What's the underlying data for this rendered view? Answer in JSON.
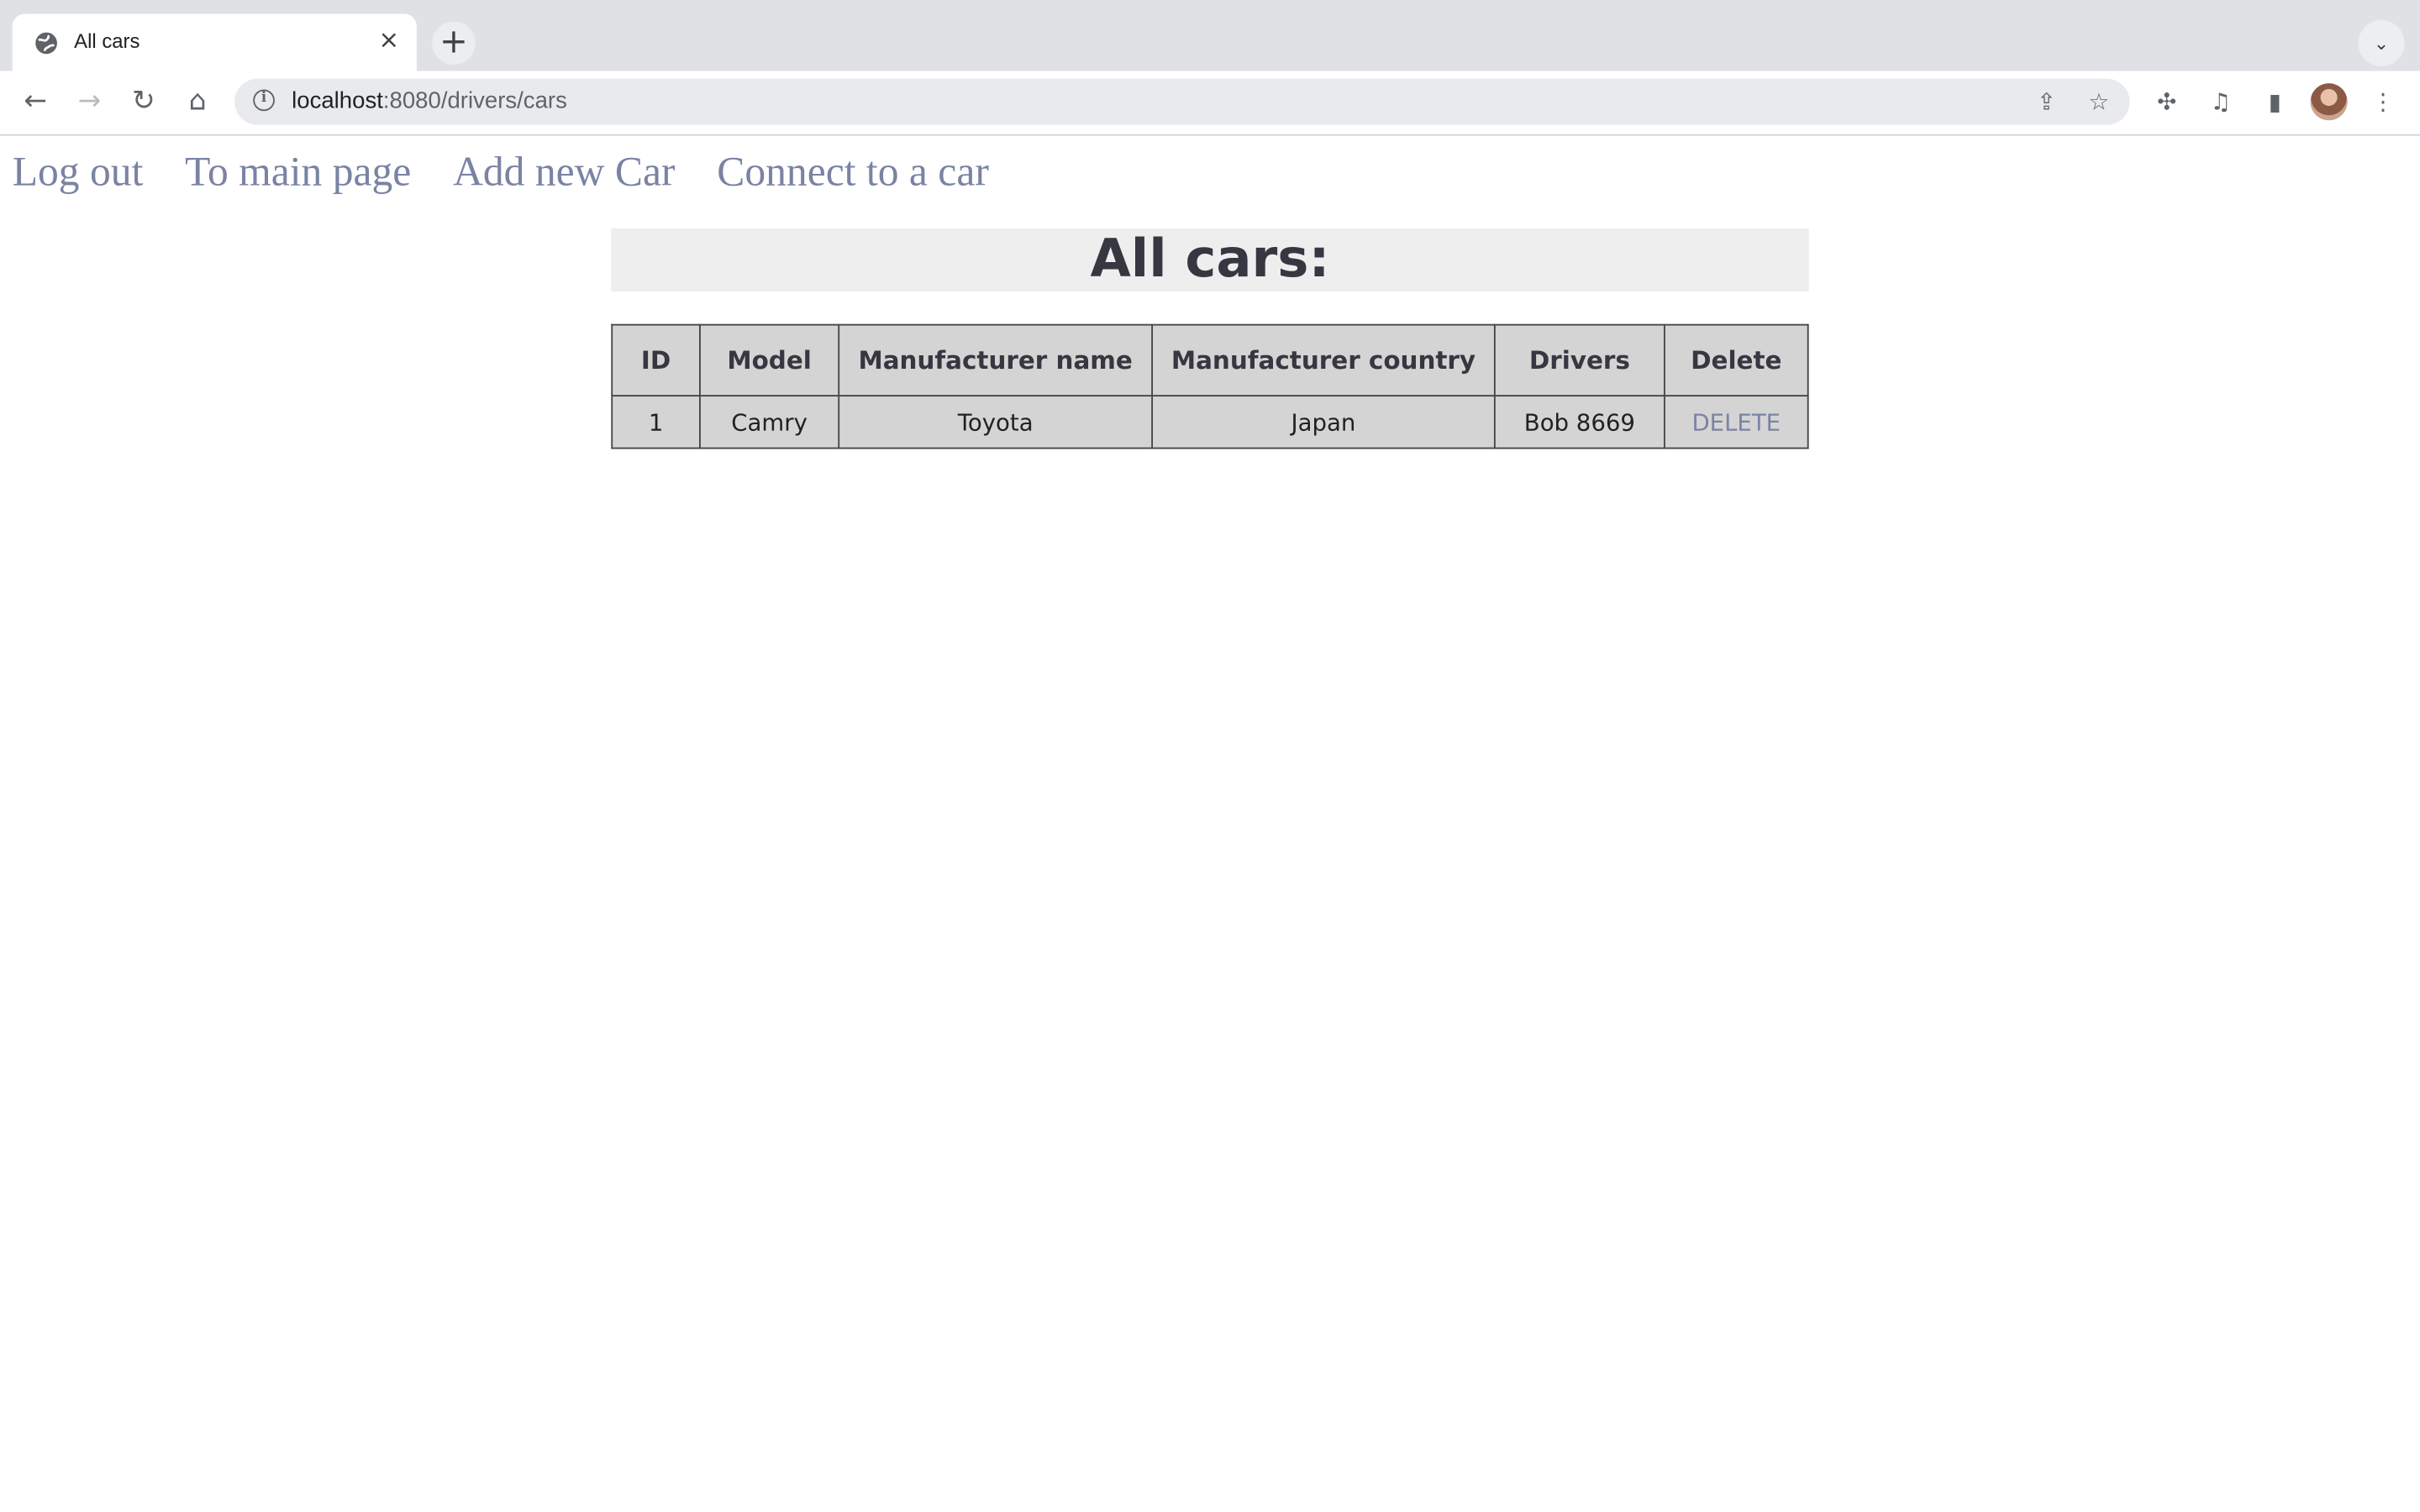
{
  "browser": {
    "tab_title": "All cars",
    "url_host": "localhost",
    "url_rest": ":8080/drivers/cars"
  },
  "nav": {
    "links": [
      "Log out",
      "To main page",
      "Add new Car",
      "Connect to a car"
    ]
  },
  "page": {
    "heading": "All cars:"
  },
  "table": {
    "headers": [
      "ID",
      "Model",
      "Manufacturer name",
      "Manufacturer country",
      "Drivers",
      "Delete"
    ],
    "rows": [
      {
        "id": "1",
        "model": "Camry",
        "manufacturer_name": "Toyota",
        "manufacturer_country": "Japan",
        "drivers": "Bob 8669",
        "delete_label": "DELETE"
      }
    ]
  },
  "colors": {
    "link": "#7a83a3",
    "heading_bg": "#eeeeee",
    "table_bg": "#d4d4d4"
  }
}
